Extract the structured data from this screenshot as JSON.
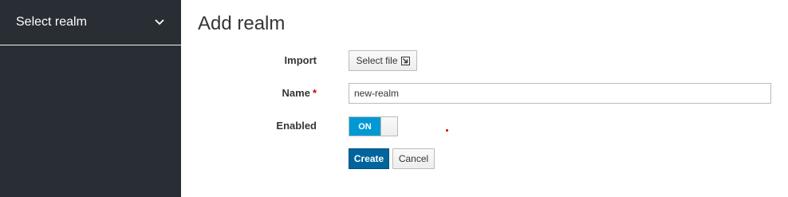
{
  "sidebar": {
    "realm_select_label": "Select realm",
    "background": "#292e34"
  },
  "main": {
    "title": "Add realm"
  },
  "form": {
    "import_label": "Import",
    "select_file_label": "Select file",
    "name_label": "Name",
    "required_marker": "*",
    "name_value": "new-realm",
    "enabled_label": "Enabled",
    "enabled_toggle_text": "ON",
    "enabled": true
  },
  "actions": {
    "create_label": "Create",
    "cancel_label": "Cancel"
  },
  "colors": {
    "primary": "#00659c",
    "toggle_on": "#0099d3",
    "required": "#cc0000"
  },
  "icons": {
    "chevron": "chevron-down-icon",
    "select_file": "import-file-icon"
  }
}
